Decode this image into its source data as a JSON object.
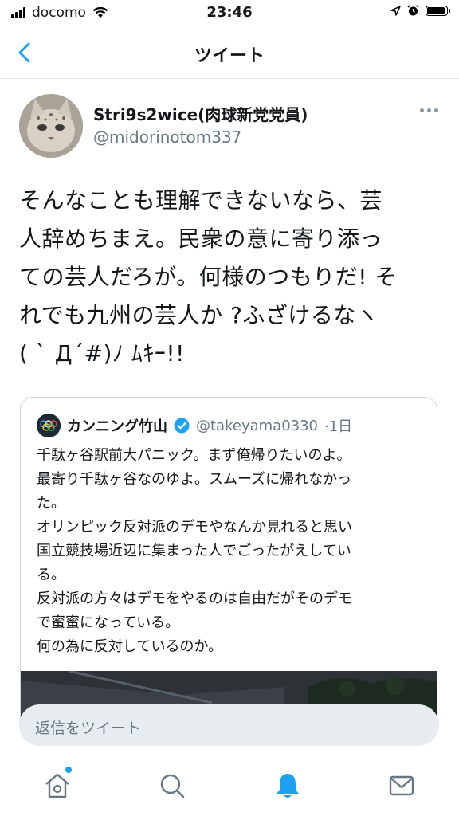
{
  "status_bar": {
    "carrier": "docomo",
    "time": "23:46"
  },
  "nav": {
    "title": "ツイート"
  },
  "tweet": {
    "display_name": "Stri9s2wice(肉球新党党員)",
    "handle": "@midorinotom337",
    "lines": [
      "そんなことも理解できないなら、芸",
      "人辞めちまえ。民衆の意に寄り添っ",
      "ての芸人だろが。何様のつもりだ! そ",
      "れでも九州の芸人か ?ふざけるなヽ",
      "( ` Д´#)ﾉ ﾑｷｰ!!"
    ]
  },
  "quoted_tweet": {
    "display_name": "カンニング竹山",
    "handle": "@takeyama0330",
    "time": "·1日",
    "lines": [
      "千駄ヶ谷駅前大パニック。まず俺帰りたいのよ。",
      "最寄り千駄ヶ谷なのゆよ。スムーズに帰れなかっ",
      "た。",
      "オリンピック反対派のデモやなんか見れると思い",
      "国立競技場近辺に集まった人でごったがえしてい",
      "る。",
      "反対派の方々はデモをやるのは自由だがそのデモ",
      "で蜜蜜になっている。",
      "何の為に反対しているのか。"
    ]
  },
  "reply": {
    "placeholder": "返信をツイート"
  },
  "tabs": {
    "icons": [
      "home-icon",
      "search-icon",
      "notifications-icon",
      "messages-icon"
    ]
  },
  "colors": {
    "accent": "#1da1f2",
    "secondary_text": "#657786",
    "border": "#e1e8ed",
    "verified": "#1da1f2"
  }
}
